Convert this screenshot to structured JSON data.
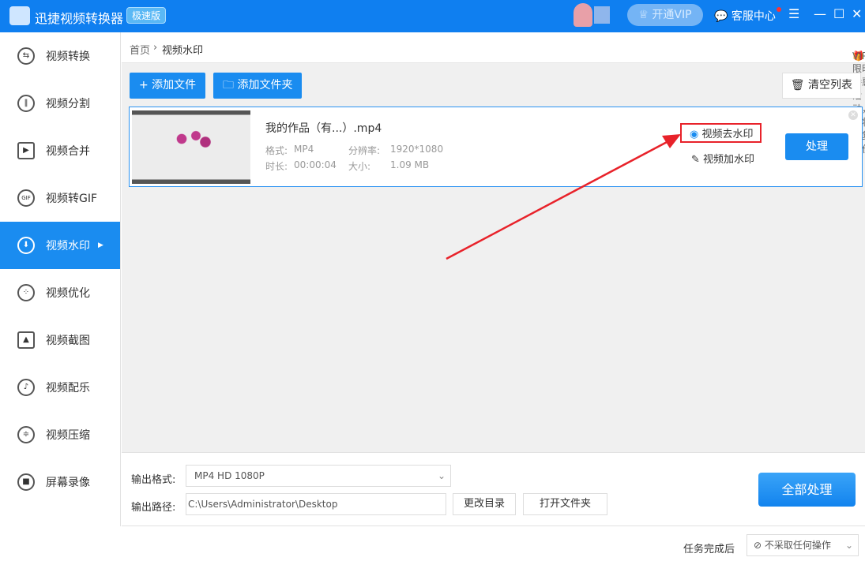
{
  "app": {
    "title": "迅捷视频转换器",
    "edition": "极速版",
    "vip_button": "开通VIP",
    "service": "客服中心"
  },
  "sidebar": {
    "items": [
      {
        "label": "视频转换",
        "icon": "swap-icon"
      },
      {
        "label": "视频分割",
        "icon": "split-icon"
      },
      {
        "label": "视频合并",
        "icon": "play-icon"
      },
      {
        "label": "视频转GIF",
        "icon": "gif-icon"
      },
      {
        "label": "视频水印",
        "icon": "watermark-icon",
        "active": true
      },
      {
        "label": "视频优化",
        "icon": "film-reel-icon"
      },
      {
        "label": "视频截图",
        "icon": "image-icon"
      },
      {
        "label": "视频配乐",
        "icon": "music-icon"
      },
      {
        "label": "视频压缩",
        "icon": "compress-icon"
      },
      {
        "label": "屏幕录像",
        "icon": "camera-icon"
      }
    ]
  },
  "breadcrumb": {
    "home": "首页",
    "sep": "›",
    "current": "视频水印"
  },
  "promo": "VIP限时特惠活动，即将恢复原价",
  "toolbar": {
    "add_file": "+ 添加文件",
    "add_folder": "添加文件夹",
    "clear": "清空列表"
  },
  "file": {
    "name": "我的作品（有...）.mp4",
    "format_label": "格式:",
    "format": "MP4",
    "res_label": "分辨率:",
    "resolution": "1920*1080",
    "dur_label": "时长:",
    "duration": "00:00:04",
    "size_label": "大小:",
    "size": "1.09 MB",
    "remove_watermark": "视频去水印",
    "add_watermark": "视频加水印",
    "process": "处理"
  },
  "output": {
    "format_label": "输出格式:",
    "format": "MP4  HD 1080P",
    "path_label": "输出路径:",
    "path": "C:\\Users\\Administrator\\Desktop",
    "change_dir": "更改目录",
    "open_folder": "打开文件夹",
    "process_all": "全部处理"
  },
  "footer": {
    "after_label": "任务完成后",
    "after_value": "不采取任何操作"
  },
  "colors": {
    "primary": "#1a8cf0",
    "highlight": "#e8222a",
    "promo": "#f08a16"
  }
}
